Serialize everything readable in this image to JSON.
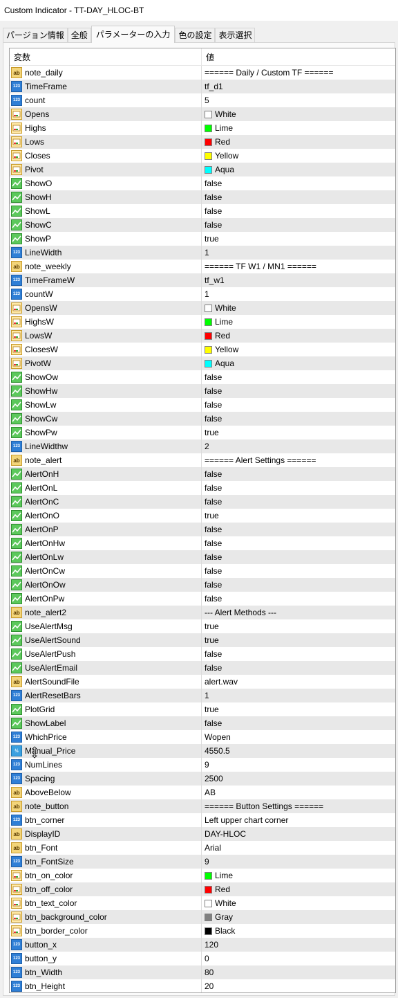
{
  "window": {
    "title": "Custom Indicator - TT-DAY_HLOC-BT"
  },
  "tabs": [
    {
      "label": "パージョン情報",
      "active": false
    },
    {
      "label": "全般",
      "active": false
    },
    {
      "label": "パラメーターの入力",
      "active": true
    },
    {
      "label": "色の設定",
      "active": false
    },
    {
      "label": "表示選択",
      "active": false
    }
  ],
  "grid": {
    "col_variable": "変数",
    "col_value": "値",
    "rows": [
      {
        "name": "note_daily",
        "type": "ab",
        "value": "====== Daily / Custom TF ======"
      },
      {
        "name": "TimeFrame",
        "type": "num",
        "value": "tf_d1"
      },
      {
        "name": "count",
        "type": "num",
        "value": "5"
      },
      {
        "name": "Opens",
        "type": "clr",
        "value": "White",
        "color": "#ffffff"
      },
      {
        "name": "Highs",
        "type": "clr",
        "value": "Lime",
        "color": "#00ff00"
      },
      {
        "name": "Lows",
        "type": "clr",
        "value": "Red",
        "color": "#ff0000"
      },
      {
        "name": "Closes",
        "type": "clr",
        "value": "Yellow",
        "color": "#ffff00"
      },
      {
        "name": "Pivot",
        "type": "clr",
        "value": "Aqua",
        "color": "#00ffff"
      },
      {
        "name": "ShowO",
        "type": "bool",
        "value": "false"
      },
      {
        "name": "ShowH",
        "type": "bool",
        "value": "false"
      },
      {
        "name": "ShowL",
        "type": "bool",
        "value": "false"
      },
      {
        "name": "ShowC",
        "type": "bool",
        "value": "false"
      },
      {
        "name": "ShowP",
        "type": "bool",
        "value": "true"
      },
      {
        "name": "LineWidth",
        "type": "num",
        "value": "1"
      },
      {
        "name": "note_weekly",
        "type": "ab",
        "value": "====== TF W1 / MN1 ======"
      },
      {
        "name": "TimeFrameW",
        "type": "num",
        "value": "tf_w1"
      },
      {
        "name": "countW",
        "type": "num",
        "value": "1"
      },
      {
        "name": "OpensW",
        "type": "clr",
        "value": "White",
        "color": "#ffffff"
      },
      {
        "name": "HighsW",
        "type": "clr",
        "value": "Lime",
        "color": "#00ff00"
      },
      {
        "name": "LowsW",
        "type": "clr",
        "value": "Red",
        "color": "#ff0000"
      },
      {
        "name": "ClosesW",
        "type": "clr",
        "value": "Yellow",
        "color": "#ffff00"
      },
      {
        "name": "PivotW",
        "type": "clr",
        "value": "Aqua",
        "color": "#00ffff"
      },
      {
        "name": "ShowOw",
        "type": "bool",
        "value": "false"
      },
      {
        "name": "ShowHw",
        "type": "bool",
        "value": "false"
      },
      {
        "name": "ShowLw",
        "type": "bool",
        "value": "false"
      },
      {
        "name": "ShowCw",
        "type": "bool",
        "value": "false"
      },
      {
        "name": "ShowPw",
        "type": "bool",
        "value": "true"
      },
      {
        "name": "LineWidthw",
        "type": "num",
        "value": "2"
      },
      {
        "name": "note_alert",
        "type": "ab",
        "value": "====== Alert Settings ======"
      },
      {
        "name": "AlertOnH",
        "type": "bool",
        "value": "false"
      },
      {
        "name": "AlertOnL",
        "type": "bool",
        "value": "false"
      },
      {
        "name": "AlertOnC",
        "type": "bool",
        "value": "false"
      },
      {
        "name": "AlertOnO",
        "type": "bool",
        "value": "true"
      },
      {
        "name": "AlertOnP",
        "type": "bool",
        "value": "false"
      },
      {
        "name": "AlertOnHw",
        "type": "bool",
        "value": "false"
      },
      {
        "name": "AlertOnLw",
        "type": "bool",
        "value": "false"
      },
      {
        "name": "AlertOnCw",
        "type": "bool",
        "value": "false"
      },
      {
        "name": "AlertOnOw",
        "type": "bool",
        "value": "false"
      },
      {
        "name": "AlertOnPw",
        "type": "bool",
        "value": "false"
      },
      {
        "name": "note_alert2",
        "type": "ab",
        "value": "--- Alert Methods ---"
      },
      {
        "name": "UseAlertMsg",
        "type": "bool",
        "value": "true"
      },
      {
        "name": "UseAlertSound",
        "type": "bool",
        "value": "true"
      },
      {
        "name": "UseAlertPush",
        "type": "bool",
        "value": "false"
      },
      {
        "name": "UseAlertEmail",
        "type": "bool",
        "value": "false"
      },
      {
        "name": "AlertSoundFile",
        "type": "ab",
        "value": "alert.wav"
      },
      {
        "name": "AlertResetBars",
        "type": "num",
        "value": "1"
      },
      {
        "name": "PlotGrid",
        "type": "bool",
        "value": "true"
      },
      {
        "name": "ShowLabel",
        "type": "bool",
        "value": "false"
      },
      {
        "name": "WhichPrice",
        "type": "num",
        "value": "Wopen"
      },
      {
        "name": "Manual_Price",
        "type": "dbl",
        "value": "4550.5"
      },
      {
        "name": "NumLines",
        "type": "num",
        "value": "9"
      },
      {
        "name": "Spacing",
        "type": "num",
        "value": "2500"
      },
      {
        "name": "AboveBelow",
        "type": "ab",
        "value": "AB"
      },
      {
        "name": "note_button",
        "type": "ab",
        "value": "====== Button Settings ======"
      },
      {
        "name": "btn_corner",
        "type": "num",
        "value": "Left upper chart corner"
      },
      {
        "name": "DisplayID",
        "type": "ab",
        "value": "DAY-HLOC"
      },
      {
        "name": "btn_Font",
        "type": "ab",
        "value": "Arial"
      },
      {
        "name": "btn_FontSize",
        "type": "num",
        "value": "9"
      },
      {
        "name": "btn_on_color",
        "type": "clr",
        "value": "Lime",
        "color": "#00ff00"
      },
      {
        "name": "btn_off_color",
        "type": "clr",
        "value": "Red",
        "color": "#ff0000"
      },
      {
        "name": "btn_text_color",
        "type": "clr",
        "value": "White",
        "color": "#ffffff"
      },
      {
        "name": "btn_background_color",
        "type": "clr",
        "value": "Gray",
        "color": "#808080"
      },
      {
        "name": "btn_border_color",
        "type": "clr",
        "value": "Black",
        "color": "#000000"
      },
      {
        "name": "button_x",
        "type": "num",
        "value": "120"
      },
      {
        "name": "button_y",
        "type": "num",
        "value": "0"
      },
      {
        "name": "btn_Width",
        "type": "num",
        "value": "80"
      },
      {
        "name": "btn_Height",
        "type": "num",
        "value": "20"
      }
    ]
  }
}
